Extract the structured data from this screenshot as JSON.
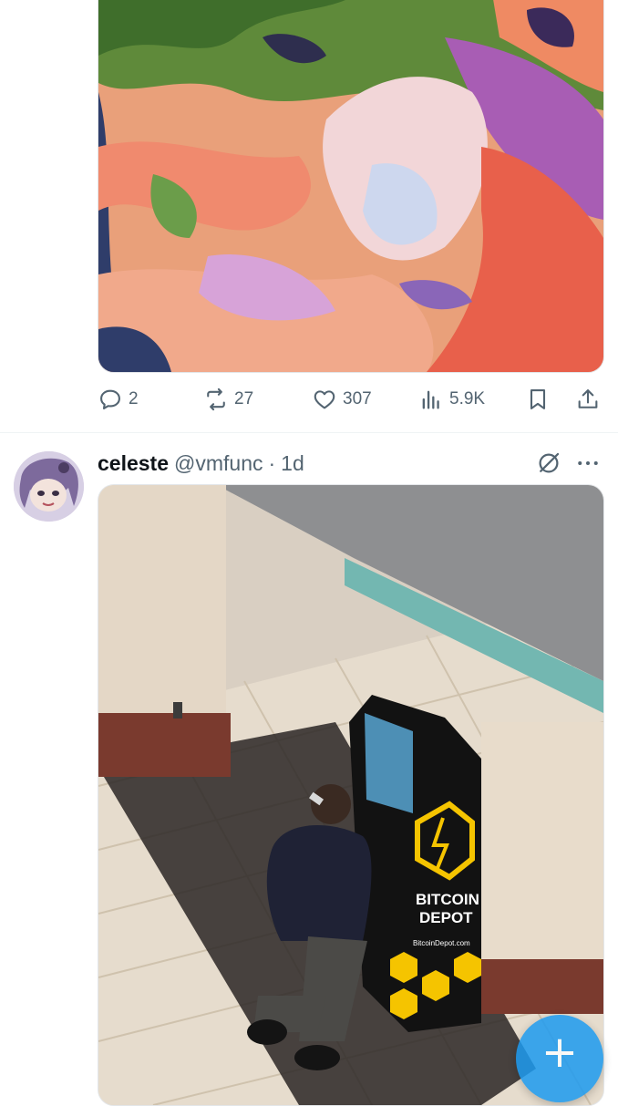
{
  "tweet_top": {
    "image_alt_icon": "painting-image",
    "actions": {
      "replies": "2",
      "reposts": "27",
      "likes": "307",
      "views": "5.9K"
    }
  },
  "tweet_second": {
    "display_name": "celeste",
    "handle": "@vmfunc",
    "separator": "·",
    "time": "1d",
    "atm_brand_line1": "BITCOIN",
    "atm_brand_line2": "DEPOT",
    "atm_url": "BitcoinDepot.com"
  },
  "fab": {
    "icon": "plus-icon",
    "symbol": "+"
  },
  "colors": {
    "accent": "#1d9bf0",
    "muted": "#536471",
    "text": "#0f1419"
  }
}
